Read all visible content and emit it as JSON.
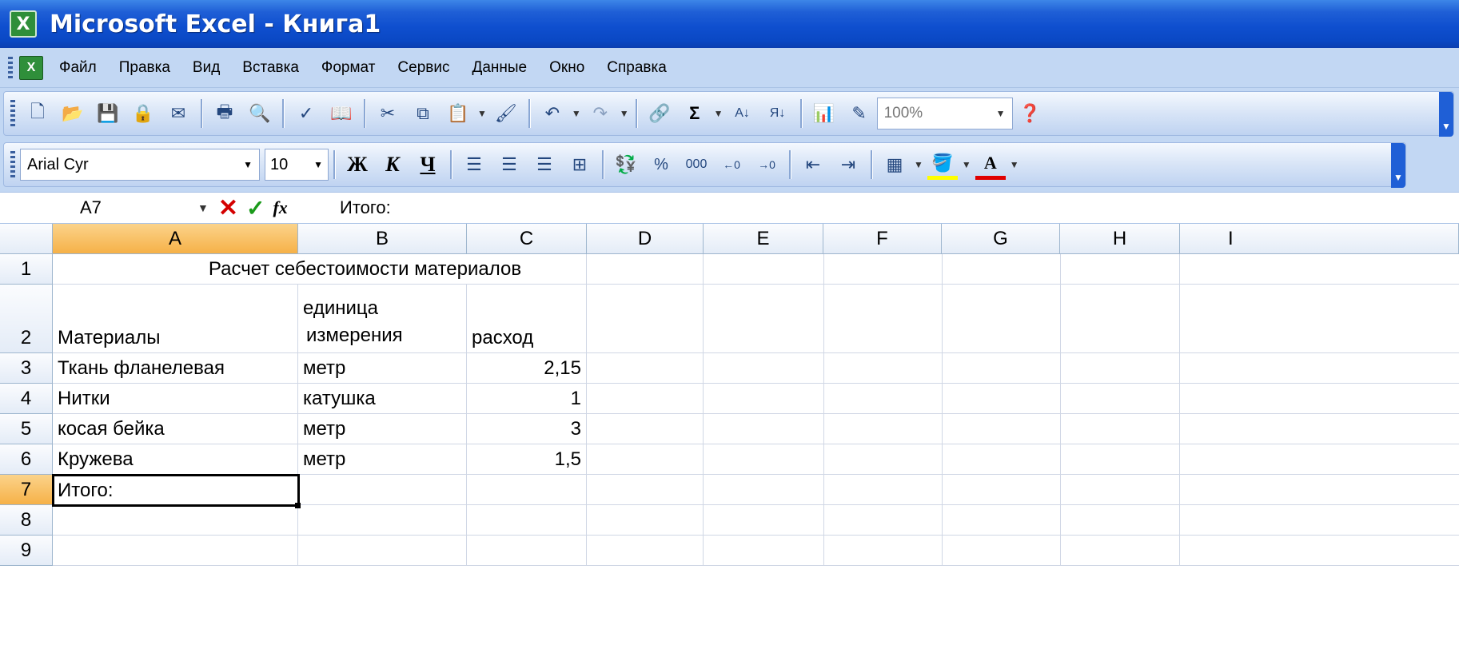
{
  "window": {
    "title": "Microsoft Excel - Книга1",
    "app_icon": "excel-icon"
  },
  "menu": {
    "items": [
      "Файл",
      "Правка",
      "Вид",
      "Вставка",
      "Формат",
      "Сервис",
      "Данные",
      "Окно",
      "Справка"
    ]
  },
  "toolbar_standard": {
    "buttons": [
      "new-icon",
      "open-icon",
      "save-icon",
      "permission-icon",
      "email-icon",
      "print-icon",
      "print-preview-icon",
      "spelling-icon",
      "research-icon",
      "cut-icon",
      "copy-icon",
      "paste-icon",
      "format-painter-icon",
      "undo-icon",
      "redo-icon",
      "hyperlink-icon",
      "autosum-icon",
      "sort-ascending-icon",
      "sort-descending-icon",
      "chart-wizard-icon",
      "drawing-icon",
      "help-icon"
    ],
    "zoom": "100%"
  },
  "toolbar_formatting": {
    "font_name": "Arial Cyr",
    "font_size": "10",
    "bold": "Ж",
    "italic": "К",
    "underline": "Ч",
    "percent": "%",
    "thousands": "000",
    "font_color_glyph": "A"
  },
  "formula_bar": {
    "name_box": "A7",
    "content": "Итого:"
  },
  "sheet": {
    "columns": [
      "A",
      "B",
      "C",
      "D",
      "E",
      "F",
      "G",
      "H",
      "I"
    ],
    "rows": [
      "1",
      "2",
      "3",
      "4",
      "5",
      "6",
      "7",
      "8",
      "9"
    ],
    "active_cell": "A7",
    "title": "Расчет себестоимости материалов",
    "headers": {
      "a": "Материалы",
      "b1": "единица",
      "b2": "измерения",
      "c": "расход"
    },
    "data": [
      {
        "a": "Ткань фланелевая",
        "b": "метр",
        "c": "2,15"
      },
      {
        "a": "Нитки",
        "b": "катушка",
        "c": "1"
      },
      {
        "a": "косая бейка",
        "b": "метр",
        "c": "3"
      },
      {
        "a": "Кружева",
        "b": "метр",
        "c": "1,5"
      }
    ],
    "total_label": "Итого:"
  },
  "colors": {
    "title_bar": "#0a48c4",
    "active_header": "#f6b148",
    "toolbar": "#c2d7f3"
  }
}
